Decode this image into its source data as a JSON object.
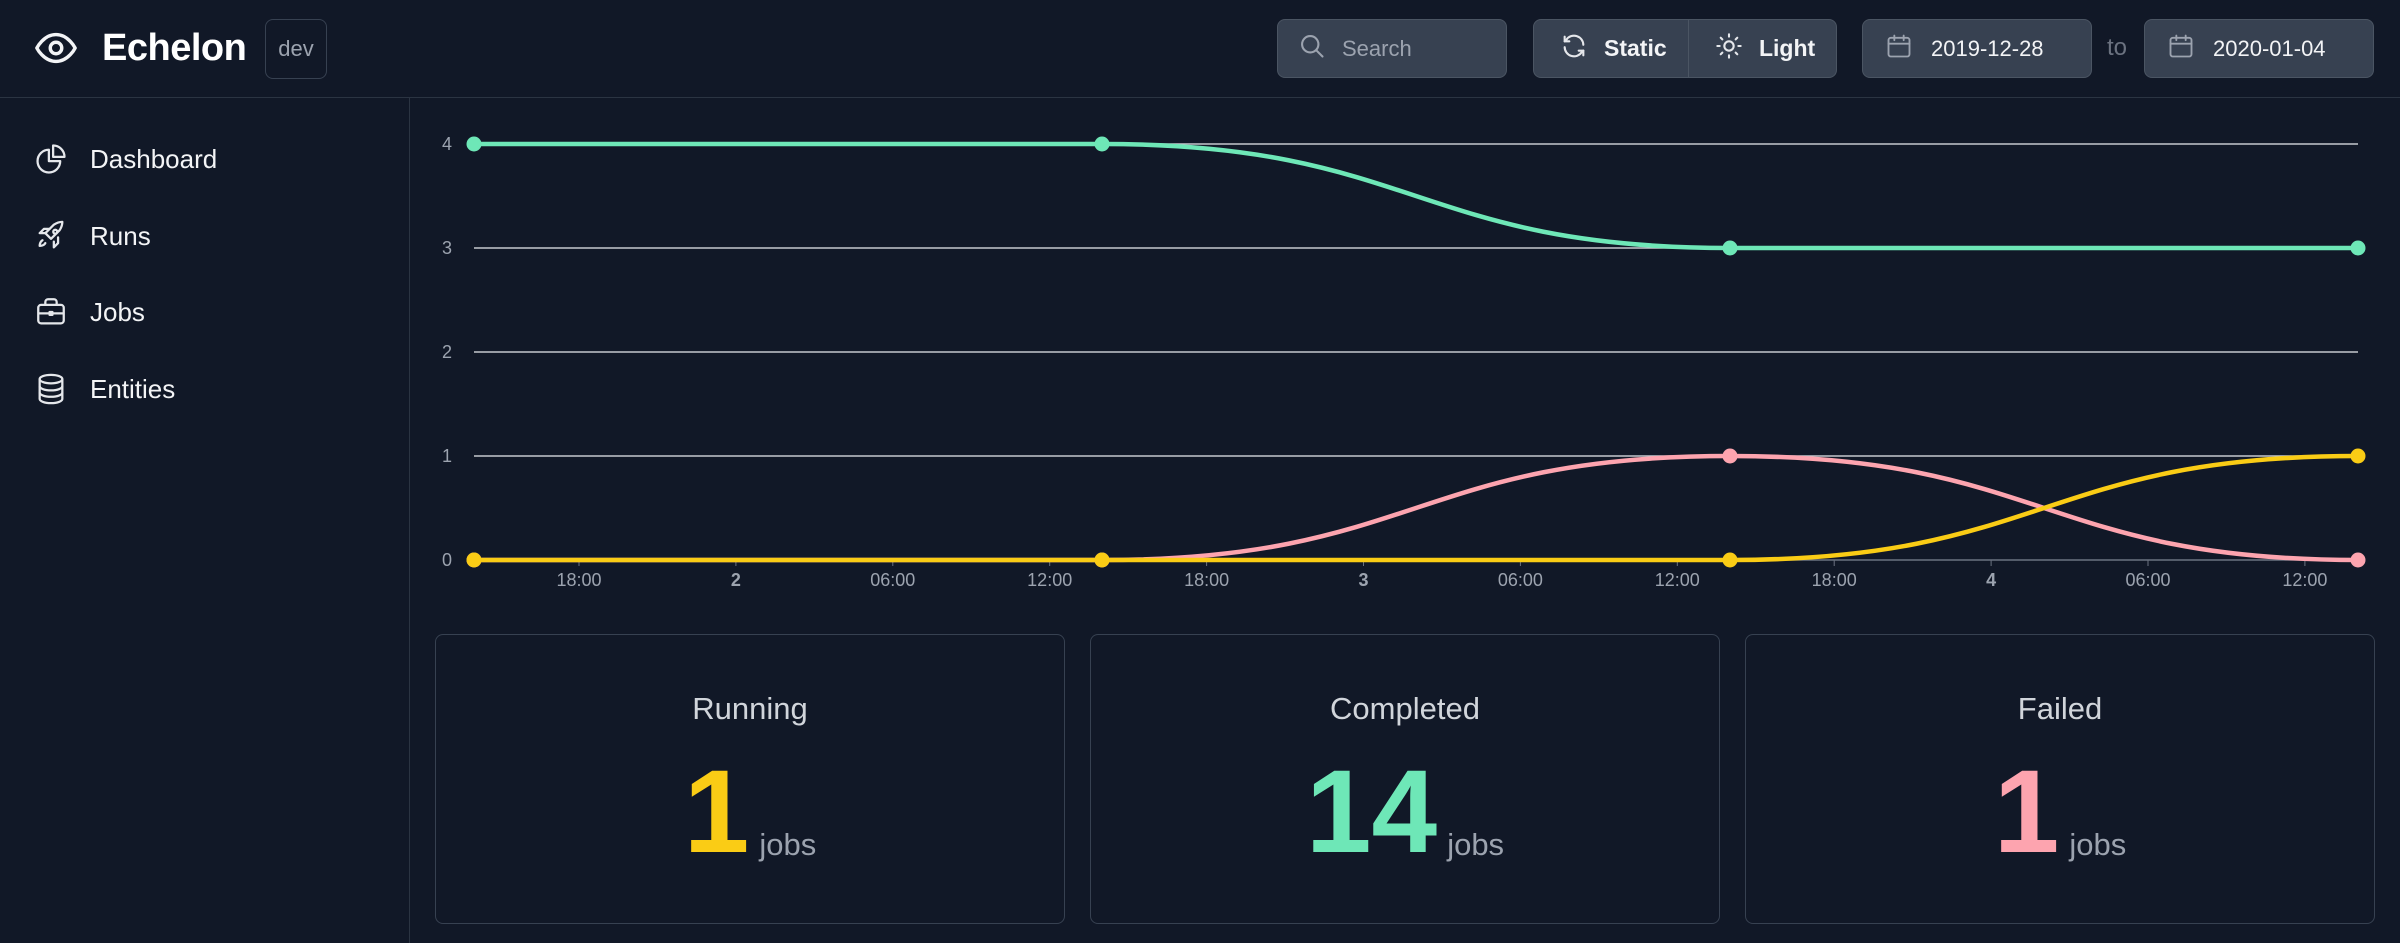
{
  "app": {
    "title": "Echelon",
    "env": "dev"
  },
  "search": {
    "placeholder": "Search",
    "value": ""
  },
  "mode_toggle": {
    "static_label": "Static",
    "theme_label": "Light"
  },
  "date_range": {
    "from": "2019-12-28",
    "separator": "to",
    "to": "2020-01-04"
  },
  "sidebar": {
    "items": [
      {
        "label": "Dashboard",
        "icon": "pie-chart-icon"
      },
      {
        "label": "Runs",
        "icon": "rocket-icon"
      },
      {
        "label": "Jobs",
        "icon": "briefcase-icon"
      },
      {
        "label": "Entities",
        "icon": "database-icon"
      }
    ]
  },
  "colors": {
    "background": "#111827",
    "completed": "#6ee7b7",
    "failed": "#fda4af",
    "running": "#facc15",
    "grid": "#e5e7eb",
    "tick": "#9ca3af"
  },
  "chart_data": {
    "type": "line",
    "x": [
      "2020-01-01 10:00",
      "2020-01-02 14:00",
      "2020-01-03 14:00",
      "2020-01-04 14:00"
    ],
    "ylim": [
      0,
      4
    ],
    "yticks": [
      "0",
      "1",
      "2",
      "3",
      "4"
    ],
    "xticks": [
      {
        "label": "18:00",
        "bold": false
      },
      {
        "label": "2",
        "bold": true
      },
      {
        "label": "06:00",
        "bold": false
      },
      {
        "label": "12:00",
        "bold": false
      },
      {
        "label": "18:00",
        "bold": false
      },
      {
        "label": "3",
        "bold": true
      },
      {
        "label": "06:00",
        "bold": false
      },
      {
        "label": "12:00",
        "bold": false
      },
      {
        "label": "18:00",
        "bold": false
      },
      {
        "label": "4",
        "bold": true
      },
      {
        "label": "06:00",
        "bold": false
      },
      {
        "label": "12:00",
        "bold": false
      }
    ],
    "grid": true,
    "series": [
      {
        "key": "completed",
        "values": [
          4,
          4,
          3,
          3
        ]
      },
      {
        "key": "failed",
        "values": [
          0,
          0,
          1,
          0
        ]
      },
      {
        "key": "running",
        "values": [
          0,
          0,
          0,
          1
        ]
      }
    ]
  },
  "stats": [
    {
      "title": "Running",
      "value": "1",
      "unit": "jobs",
      "color": "#facc15"
    },
    {
      "title": "Completed",
      "value": "14",
      "unit": "jobs",
      "color": "#6ee7b7"
    },
    {
      "title": "Failed",
      "value": "1",
      "unit": "jobs",
      "color": "#fda4af"
    }
  ]
}
